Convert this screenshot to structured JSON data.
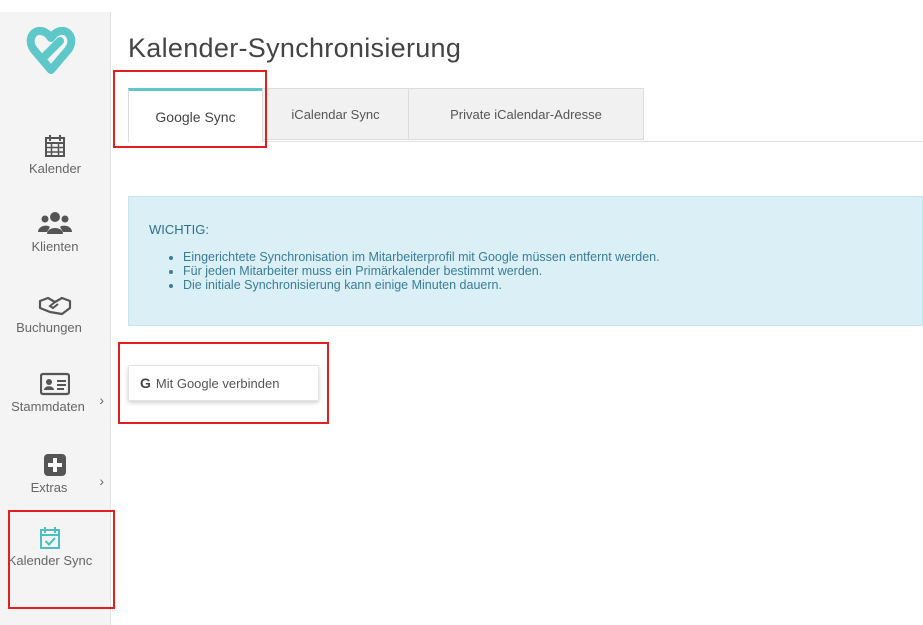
{
  "page": {
    "title": "Kalender-Synchronisierung"
  },
  "sidebar": {
    "items": [
      {
        "label": "Kalender",
        "icon": "calendar-icon"
      },
      {
        "label": "Klienten",
        "icon": "people-icon"
      },
      {
        "label": "Buchungen",
        "icon": "handshake-icon"
      },
      {
        "label": "Stammdaten",
        "icon": "id-card-icon"
      },
      {
        "label": "Extras",
        "icon": "plus-square-icon"
      },
      {
        "label": "Kalender Sync",
        "icon": "calendar-check-icon"
      }
    ]
  },
  "tabs": [
    {
      "label": "Google Sync",
      "active": true
    },
    {
      "label": "iCalendar Sync",
      "active": false
    },
    {
      "label": "Private iCalendar-Adresse",
      "active": false
    }
  ],
  "notice": {
    "title": "WICHTIG:",
    "items": [
      "Eingerichtete Synchronisation im Mitarbeiterprofil mit Google müssen entfernt werden.",
      "Für jeden Mitarbeiter muss ein Primärkalender bestimmt werden.",
      "Die initiale Synchronisierung kann einige Minuten dauern."
    ]
  },
  "google_button": {
    "icon_letter": "G",
    "label": "Mit Google verbinden"
  },
  "colors": {
    "accent": "#5ec8c9",
    "alert_bg": "#dbeff7",
    "highlight": "#e0201f",
    "sync_icon": "#4bbfc3"
  }
}
